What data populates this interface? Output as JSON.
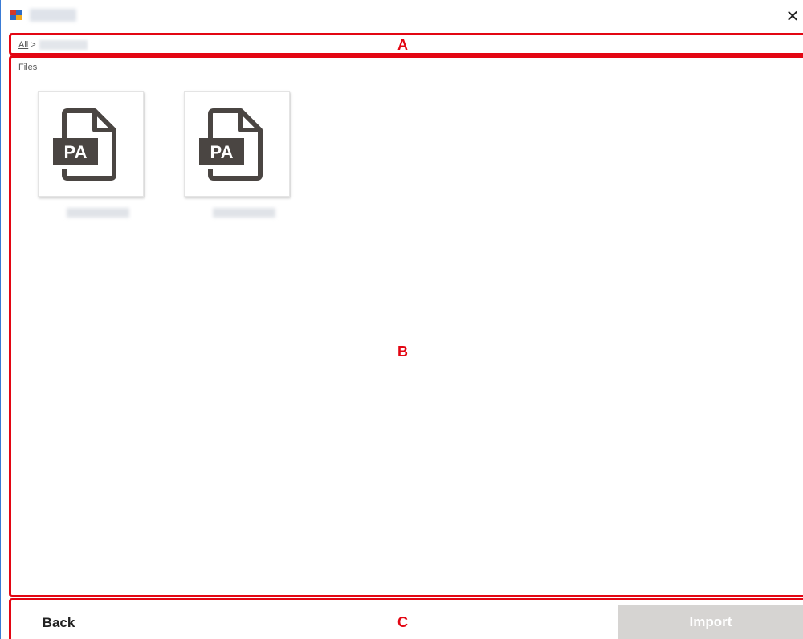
{
  "window": {
    "close_glyph": "✕"
  },
  "breadcrumb": {
    "root_label": "All",
    "separator": ">"
  },
  "files_section": {
    "label": "Files",
    "items": [
      {
        "icon_label": "PA",
        "icon": "pa-document-icon"
      },
      {
        "icon_label": "PA",
        "icon": "pa-document-icon"
      }
    ]
  },
  "annotations": {
    "a": "A",
    "b": "B",
    "c": "C"
  },
  "footer": {
    "back_label": "Back",
    "import_label": "Import"
  },
  "colors": {
    "annotation_red": "#e30613",
    "import_disabled_bg": "#d6d4d2",
    "icon_dark": "#4a4542"
  }
}
